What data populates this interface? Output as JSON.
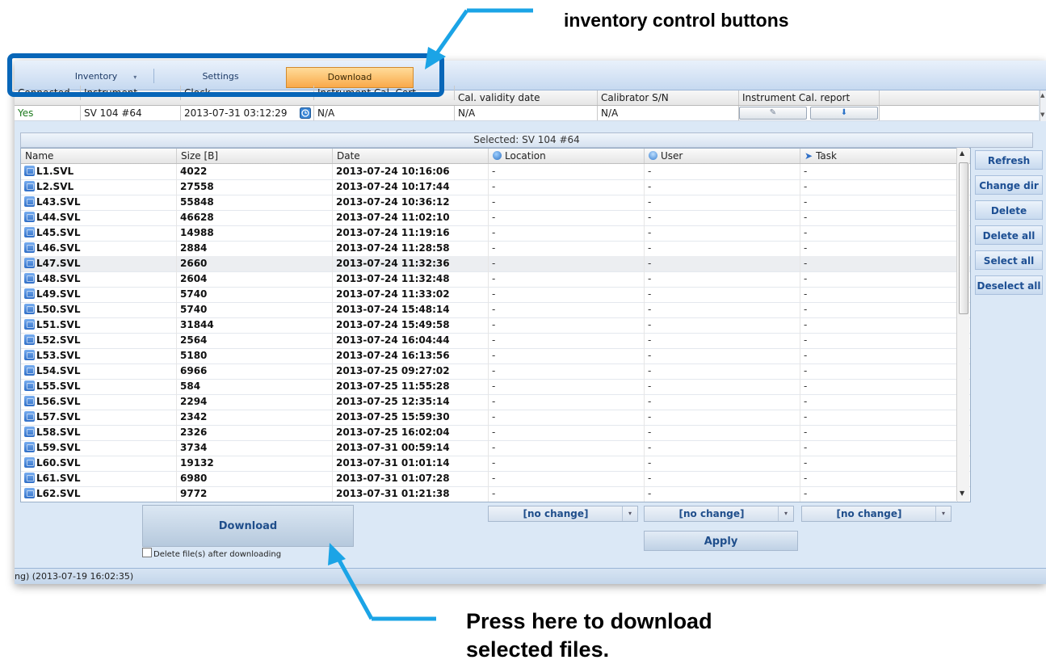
{
  "callouts": {
    "top": "inventory control buttons",
    "bottom": "Press here to download selected files."
  },
  "menubar": {
    "items": [
      {
        "label": "Inventory",
        "active": false
      },
      {
        "label": "Settings",
        "active": false
      },
      {
        "label": "Download",
        "active": true
      }
    ]
  },
  "instrument_table": {
    "headers": [
      "Connected",
      "Instrument",
      "Clock",
      "Instrument Cal. Cert.",
      "Cal. validity date",
      "Calibrator S/N",
      "Instrument Cal. report"
    ],
    "row": {
      "connected": "Yes",
      "instrument": "SV 104 #64",
      "clock": "2013-07-31 03:12:29",
      "cal_cert": "N/A",
      "cal_validity": "N/A",
      "calibrator_sn": "N/A"
    }
  },
  "selected_label": "Selected: SV 104 #64",
  "file_table": {
    "headers": {
      "name": "Name",
      "size": "Size [B]",
      "date": "Date",
      "location": "Location",
      "user": "User",
      "task": "Task"
    },
    "rows": [
      {
        "name": "L1.SVL",
        "size": "4022",
        "date": "2013-07-24 10:16:06",
        "location": "-",
        "user": "-",
        "task": "-"
      },
      {
        "name": "L2.SVL",
        "size": "27558",
        "date": "2013-07-24 10:17:44",
        "location": "-",
        "user": "-",
        "task": "-"
      },
      {
        "name": "L43.SVL",
        "size": "55848",
        "date": "2013-07-24 10:36:12",
        "location": "-",
        "user": "-",
        "task": "-"
      },
      {
        "name": "L44.SVL",
        "size": "46628",
        "date": "2013-07-24 11:02:10",
        "location": "-",
        "user": "-",
        "task": "-"
      },
      {
        "name": "L45.SVL",
        "size": "14988",
        "date": "2013-07-24 11:19:16",
        "location": "-",
        "user": "-",
        "task": "-"
      },
      {
        "name": "L46.SVL",
        "size": "2884",
        "date": "2013-07-24 11:28:58",
        "location": "-",
        "user": "-",
        "task": "-"
      },
      {
        "name": "L47.SVL",
        "size": "2660",
        "date": "2013-07-24 11:32:36",
        "location": "-",
        "user": "-",
        "task": "-"
      },
      {
        "name": "L48.SVL",
        "size": "2604",
        "date": "2013-07-24 11:32:48",
        "location": "-",
        "user": "-",
        "task": "-"
      },
      {
        "name": "L49.SVL",
        "size": "5740",
        "date": "2013-07-24 11:33:02",
        "location": "-",
        "user": "-",
        "task": "-"
      },
      {
        "name": "L50.SVL",
        "size": "5740",
        "date": "2013-07-24 15:48:14",
        "location": "-",
        "user": "-",
        "task": "-"
      },
      {
        "name": "L51.SVL",
        "size": "31844",
        "date": "2013-07-24 15:49:58",
        "location": "-",
        "user": "-",
        "task": "-"
      },
      {
        "name": "L52.SVL",
        "size": "2564",
        "date": "2013-07-24 16:04:44",
        "location": "-",
        "user": "-",
        "task": "-"
      },
      {
        "name": "L53.SVL",
        "size": "5180",
        "date": "2013-07-24 16:13:56",
        "location": "-",
        "user": "-",
        "task": "-"
      },
      {
        "name": "L54.SVL",
        "size": "6966",
        "date": "2013-07-25 09:27:02",
        "location": "-",
        "user": "-",
        "task": "-"
      },
      {
        "name": "L55.SVL",
        "size": "584",
        "date": "2013-07-25 11:55:28",
        "location": "-",
        "user": "-",
        "task": "-"
      },
      {
        "name": "L56.SVL",
        "size": "2294",
        "date": "2013-07-25 12:35:14",
        "location": "-",
        "user": "-",
        "task": "-"
      },
      {
        "name": "L57.SVL",
        "size": "2342",
        "date": "2013-07-25 15:59:30",
        "location": "-",
        "user": "-",
        "task": "-"
      },
      {
        "name": "L58.SVL",
        "size": "2326",
        "date": "2013-07-25 16:02:04",
        "location": "-",
        "user": "-",
        "task": "-"
      },
      {
        "name": "L59.SVL",
        "size": "3734",
        "date": "2013-07-31 00:59:14",
        "location": "-",
        "user": "-",
        "task": "-"
      },
      {
        "name": "L60.SVL",
        "size": "19132",
        "date": "2013-07-31 01:01:14",
        "location": "-",
        "user": "-",
        "task": "-"
      },
      {
        "name": "L61.SVL",
        "size": "6980",
        "date": "2013-07-31 01:07:28",
        "location": "-",
        "user": "-",
        "task": "-"
      },
      {
        "name": "L62.SVL",
        "size": "9772",
        "date": "2013-07-31 01:21:38",
        "location": "-",
        "user": "-",
        "task": "-"
      }
    ]
  },
  "side_buttons": [
    "Refresh",
    "Change dir",
    "Delete",
    "Delete all",
    "Select all",
    "Deselect all"
  ],
  "download": {
    "button_label": "Download",
    "delete_checkbox_label": "Delete file(s) after downloading"
  },
  "combos": {
    "location": "[no change]",
    "user": "[no change]",
    "task": "[no change]"
  },
  "apply_label": "Apply",
  "status_text": "ng) (2013-07-19 16:02:35)",
  "colors": {
    "accent": "#0866b8",
    "active_tab": "#f9a94a",
    "connected_yes": "#1d7a1d"
  }
}
